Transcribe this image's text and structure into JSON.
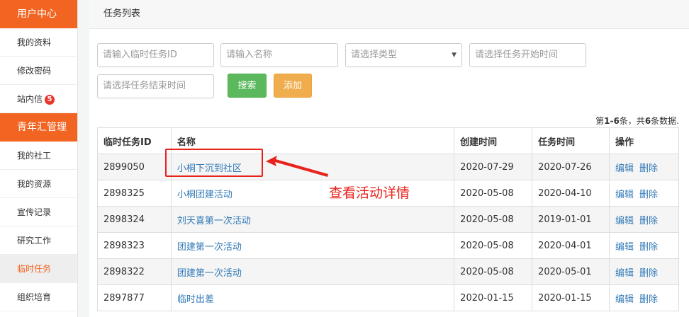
{
  "sidebar": {
    "section1_title": "用户中心",
    "items1": [
      {
        "label": "我的资料"
      },
      {
        "label": "修改密码"
      },
      {
        "label": "站内信",
        "badge": "5"
      }
    ],
    "section2_title": "青年汇管理",
    "items2": [
      {
        "label": "我的社工"
      },
      {
        "label": "我的资源"
      },
      {
        "label": "宣传记录"
      },
      {
        "label": "研究工作"
      },
      {
        "label": "临时任务"
      },
      {
        "label": "组织培育"
      }
    ]
  },
  "panel": {
    "title": "任务列表"
  },
  "filters": {
    "task_id_placeholder": "请输入临时任务ID",
    "name_placeholder": "请输入名称",
    "type_placeholder": "请选择类型",
    "start_placeholder": "请选择任务开始时间",
    "end_placeholder": "请选择任务结束时间",
    "search_label": "搜索",
    "add_label": "添加"
  },
  "summary": {
    "prefix": "第",
    "range": "1-6",
    "mid": "条，共",
    "total": "6",
    "suffix": "条数据."
  },
  "table": {
    "headers": [
      "临时任务ID",
      "名称",
      "创建时间",
      "任务时间",
      "操作"
    ],
    "edit_label": "编辑",
    "delete_label": "删除",
    "rows": [
      {
        "id": "2899050",
        "name": "小桐下沉到社区",
        "created": "2020-07-29",
        "task_date": "2020-07-26"
      },
      {
        "id": "2898325",
        "name": "小桐团建活动",
        "created": "2020-05-08",
        "task_date": "2020-04-10"
      },
      {
        "id": "2898324",
        "name": "刘天喜第一次活动",
        "created": "2020-05-08",
        "task_date": "2019-01-01"
      },
      {
        "id": "2898323",
        "name": "团建第一次活动",
        "created": "2020-05-08",
        "task_date": "2020-04-01"
      },
      {
        "id": "2898322",
        "name": "团建第一次活动",
        "created": "2020-05-08",
        "task_date": "2020-05-01"
      },
      {
        "id": "2897877",
        "name": "临时出差",
        "created": "2020-01-15",
        "task_date": "2020-01-15"
      }
    ]
  },
  "annotation": {
    "text": "查看活动详情"
  },
  "colors": {
    "brand": "#f26421",
    "annotation": "#e8221c",
    "link": "#337ab7",
    "search": "#5cb85c",
    "add": "#f0ad4e"
  }
}
